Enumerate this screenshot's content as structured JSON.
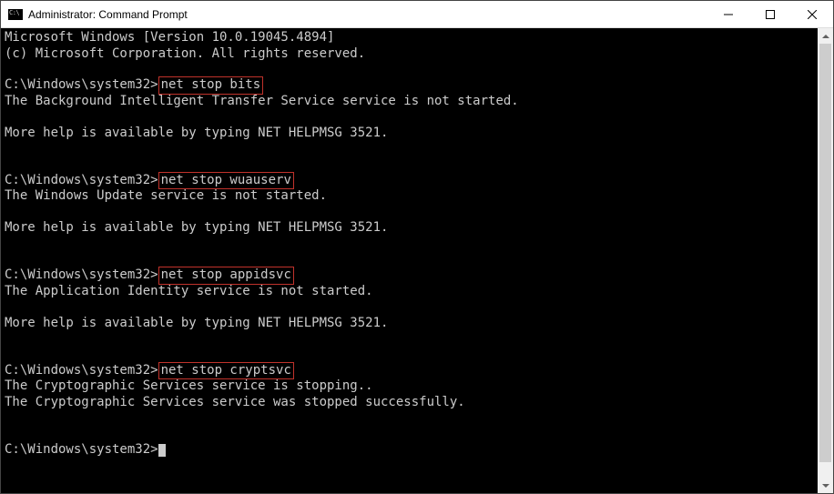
{
  "window": {
    "title": "Administrator: Command Prompt"
  },
  "banner": {
    "line1": "Microsoft Windows [Version 10.0.19045.4894]",
    "line2": "(c) Microsoft Corporation. All rights reserved."
  },
  "prompt_text": "C:\\Windows\\system32>",
  "help_line": "More help is available by typing NET HELPMSG 3521.",
  "sessions": [
    {
      "command": "net stop bits",
      "response1": "The Background Intelligent Transfer Service service is not started.",
      "response2": "",
      "show_help": true
    },
    {
      "command": "net stop wuauserv",
      "response1": "The Windows Update service is not started.",
      "response2": "",
      "show_help": true
    },
    {
      "command": "net stop appidsvc",
      "response1": "The Application Identity service is not started.",
      "response2": "",
      "show_help": true
    },
    {
      "command": "net stop cryptsvc",
      "response1": "The Cryptographic Services service is stopping..",
      "response2": "The Cryptographic Services service was stopped successfully.",
      "show_help": false
    }
  ]
}
